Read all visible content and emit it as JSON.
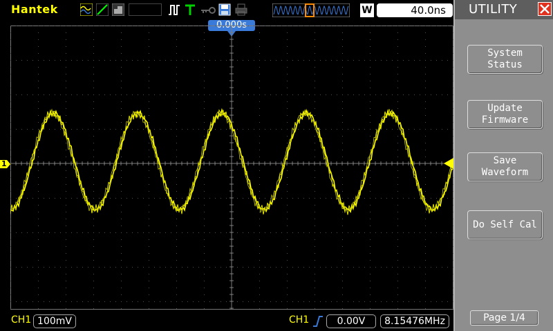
{
  "brand": "Hantek",
  "time_scale": "40.0ns",
  "window_label": "W",
  "trigger_position": "0.000s",
  "channel": {
    "label": "CH1",
    "volts_per_div": "100mV",
    "trigger_channel": "CH1",
    "trigger_level": "0.00V",
    "frequency": "8.15476MHz",
    "marker": "1"
  },
  "panel": {
    "title": "UTILITY",
    "buttons": [
      {
        "line1": "System",
        "line2": "Status"
      },
      {
        "line1": "Update",
        "line2": "Firmware"
      },
      {
        "line1": "Save",
        "line2": "Waveform"
      },
      {
        "line1": "Do Self Cal",
        "line2": ""
      }
    ],
    "page": "Page 1/4"
  },
  "colors": {
    "trace": "#ffff00",
    "grid": "#7a7a7a",
    "panel_bg": "#8e8e8e",
    "accent": "#3a7ad8"
  },
  "icons": [
    "trace-mode-icon",
    "line-mode-icon",
    "persist-icon",
    "pulse-icon",
    "trigger-t-icon",
    "key-icon",
    "save-icon",
    "printer-icon",
    "timebase-overview-icon"
  ]
}
